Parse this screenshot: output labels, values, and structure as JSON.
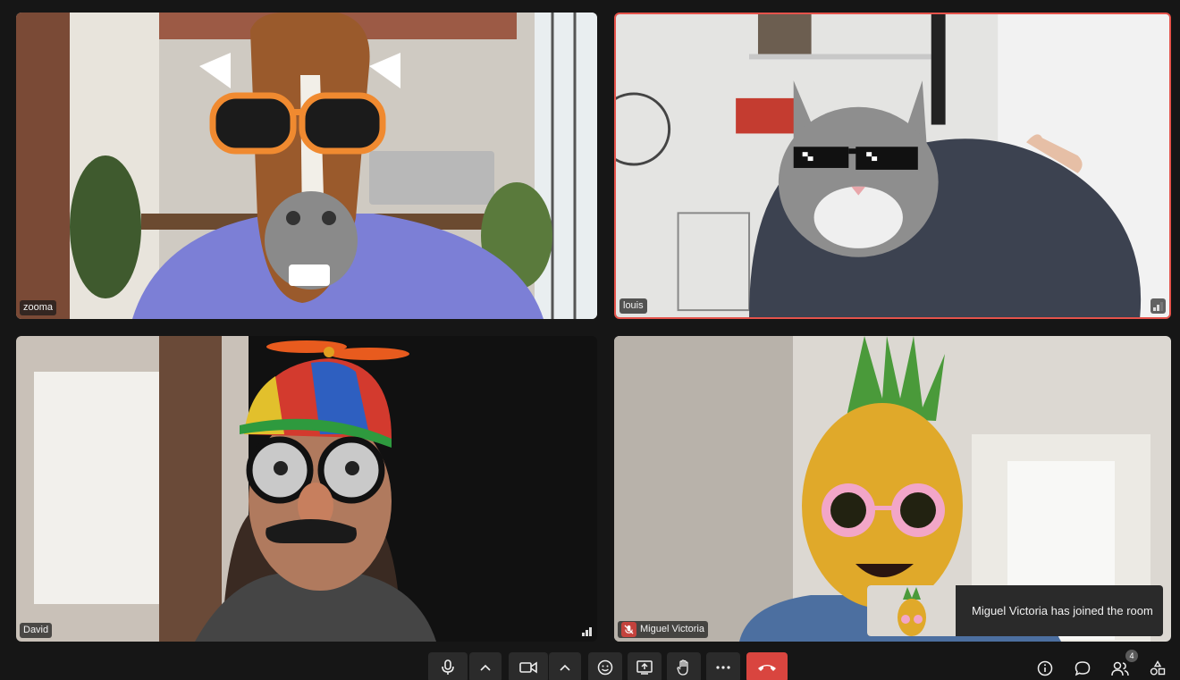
{
  "participants": [
    {
      "name": "zooma",
      "filter": "horse-head-with-orange-sunglasses",
      "active": false
    },
    {
      "name": "louis",
      "filter": "cat-head-with-pixel-sunglasses",
      "active": true
    },
    {
      "name": "David",
      "filter": "propeller-cap-and-disguise-glasses",
      "active": false
    },
    {
      "name": "Miguel Victoria",
      "filter": "pineapple-head-with-flower-sunglasses",
      "active": false,
      "muted": true
    }
  ],
  "toast": {
    "message": "Miguel Victoria has joined the room"
  },
  "toolbar": {
    "buttons": [
      "microphone",
      "microphone-options",
      "camera",
      "camera-options",
      "reactions",
      "share-screen",
      "raise-hand",
      "more-options",
      "leave-call"
    ],
    "right_icons": [
      "info",
      "chat",
      "participants",
      "activities"
    ],
    "participant_count": "4"
  },
  "colors": {
    "background": "#161616",
    "active_border": "#e5534b",
    "end_call": "#d9453f",
    "button": "#2b2b2b"
  }
}
